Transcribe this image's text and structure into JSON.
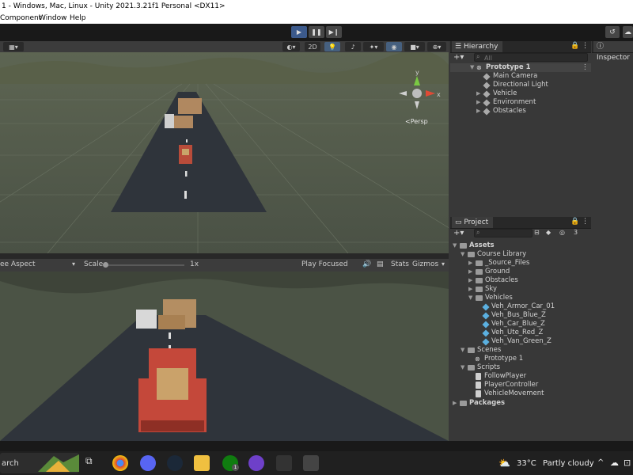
{
  "window": {
    "title": "1 - Windows, Mac, Linux - Unity 2021.3.21f1 Personal <DX11>"
  },
  "menu": {
    "items": [
      "Component",
      "Window",
      "Help"
    ]
  },
  "toolbar": {
    "play_icon": "play-icon",
    "pause_icon": "pause-icon",
    "step_icon": "step-icon"
  },
  "scene": {
    "view_mode": "2D",
    "persp_label": "<Persp",
    "axis_y": "y",
    "axis_x": "x"
  },
  "game": {
    "aspect": "ee Aspect",
    "scale_label": "Scale",
    "scale_value": "1x",
    "play_mode": "Play Focused",
    "stats": "Stats",
    "gizmos": "Gizmos"
  },
  "hierarchy": {
    "tab": "Hierarchy",
    "search_placeholder": "All",
    "scene_root": "Prototype 1",
    "items": [
      "Main Camera",
      "Directional Light",
      "Vehicle",
      "Environment",
      "Obstacles"
    ]
  },
  "project": {
    "tab": "Project",
    "badge": "3",
    "tree": {
      "assets": "Assets",
      "course_library": "Course Library",
      "source_files": "_Source_Files",
      "ground": "Ground",
      "obstacles": "Obstacles",
      "sky": "Sky",
      "vehicles": "Vehicles",
      "vehicle_items": [
        "Veh_Armor_Car_01",
        "Veh_Bus_Blue_Z",
        "Veh_Car_Blue_Z",
        "Veh_Ute_Red_Z",
        "Veh_Van_Green_Z"
      ],
      "scenes": "Scenes",
      "scene_item": "Prototype 1",
      "scripts": "Scripts",
      "script_items": [
        "FollowPlayer",
        "PlayerController",
        "VehicleMovement"
      ],
      "packages": "Packages"
    }
  },
  "inspector": {
    "tab": "Inspector"
  },
  "taskbar": {
    "search_text": "arch",
    "weather_temp": "33°C",
    "weather_text": "Partly cloudy",
    "xbox_badge": "1"
  },
  "colors": {
    "accent": "#3c5a8c",
    "panel": "#383838",
    "toolbar": "#191919",
    "cube_icon": "#5bb0e0"
  }
}
